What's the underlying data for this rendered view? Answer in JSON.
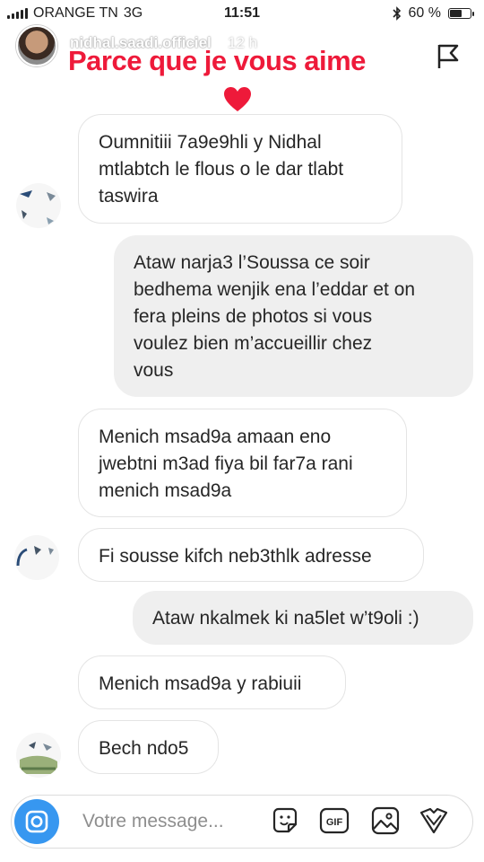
{
  "status": {
    "carrier": "ORANGE TN",
    "network": "3G",
    "time": "11:51",
    "battery": "60 %",
    "battery_level": 0.6
  },
  "story": {
    "username": "nidhal.saadi.officiel",
    "time_ago": "12 h",
    "caption": "Parce que je vous aime",
    "caption_color": "#ee1a3a"
  },
  "messages": [
    {
      "side": "in",
      "lines": [
        "Oumnitiii 7a9e9hli y Nidhal",
        "mtlabtch le flous o le dar tlabt",
        "taswira"
      ]
    },
    {
      "side": "out",
      "lines": [
        "Ataw narja3 l’Soussa ce soir",
        "bedhema wenjik ena l’eddar et on",
        "fera pleins de photos si vous",
        "voulez bien m’accueillir chez",
        "vous"
      ]
    },
    {
      "side": "in",
      "lines": [
        "Menich msad9a amaan eno",
        "jwebtni m3ad fiya bil far7a rani",
        "menich msad9a"
      ]
    },
    {
      "side": "in",
      "lines": [
        "Fi sousse kifch neb3thlk adresse"
      ]
    },
    {
      "side": "out",
      "lines": [
        "Ataw nkalmek ki na5let w’t9oli :)"
      ]
    },
    {
      "side": "in",
      "lines": [
        "Menich msad9a y rabiuii"
      ]
    },
    {
      "side": "in",
      "lines": [
        "Bech ndo5"
      ]
    }
  ],
  "composer": {
    "placeholder": "Votre message...",
    "camera_icon": "camera-icon",
    "icons": [
      "sticker-icon",
      "gif-icon",
      "gallery-icon",
      "heart-outline-icon"
    ]
  },
  "colors": {
    "accent": "#3797f0",
    "bubble_out": "#efefef",
    "bubble_in_border": "#e4e4e4"
  }
}
